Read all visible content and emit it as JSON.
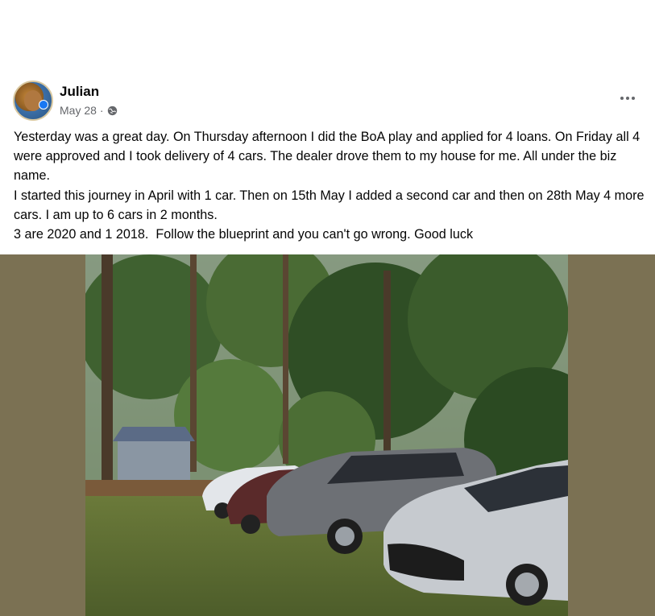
{
  "post": {
    "author": "Julian",
    "date": "May 28",
    "separator": "·",
    "audience_icon": "globe-icon",
    "more_icon": "more-options-icon",
    "paragraphs": [
      "Yesterday was a great day. On Thursday afternoon I did the BoA play and applied for 4 loans. On Friday all 4 were approved and I took delivery of 4 cars. The dealer drove them to my house for me. All under the biz name.",
      "I started this journey in April with 1 car. Then on 15th May I added a second car and then on 28th May 4 more cars. I am up to 6 cars in 2 months.",
      "3 are 2020 and 1 2018.  Follow the blueprint and you can't go wrong. Good luck"
    ]
  },
  "colors": {
    "text": "#050505",
    "secondary_text": "#65676b",
    "photo_backdrop": "#7b7153"
  }
}
